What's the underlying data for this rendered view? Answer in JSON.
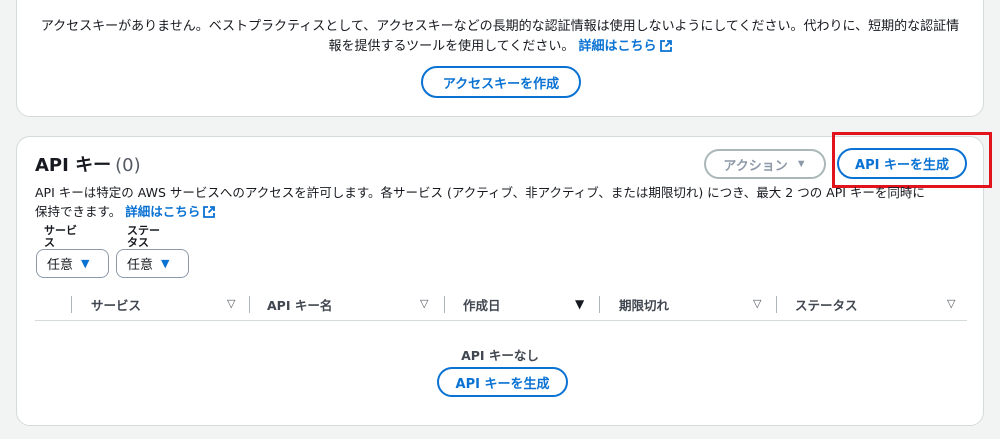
{
  "access_keys": {
    "message": "アクセスキーがありません。ベストプラクティスとして、アクセスキーなどの長期的な認証情報は使用しないようにしてください。代わりに、短期的な認証情",
    "message_line2": "報を提供するツールを使用してください。",
    "learn_more": "詳細はこちら",
    "create_button": "アクセスキーを作成"
  },
  "api_keys": {
    "title": "API キー",
    "count": "(0)",
    "actions_button": "アクション",
    "generate_button": "API キーを生成",
    "description_line1": "API キーは特定の AWS サービスへのアクセスを許可します。各サービス (アクティブ、非アクティブ、または期限切れ) につき、最大 2 つの API キーを同時に",
    "description_line2": "保持できます。",
    "learn_more": "詳細はこちら",
    "filters": {
      "service_label": "サービ\nス",
      "service_value": "任意",
      "status_label": "ステー\nタス",
      "status_value": "任意"
    },
    "columns": [
      "サービス",
      "API キー名",
      "作成日",
      "期限切れ",
      "ステータス"
    ],
    "empty_title": "API キーなし",
    "empty_generate_button": "API キーを生成"
  },
  "colors": {
    "accent": "#0972d3",
    "highlight": "#e0141a"
  }
}
